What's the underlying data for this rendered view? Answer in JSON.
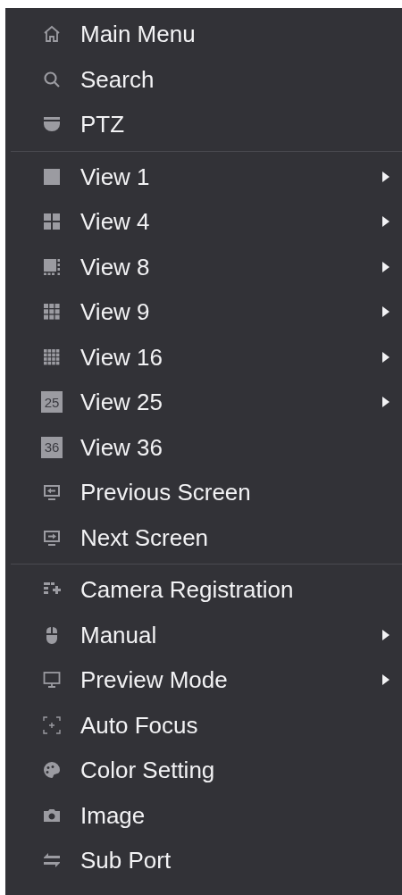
{
  "menu": {
    "sections": [
      {
        "items": [
          {
            "label": "Main Menu",
            "submenu": false
          },
          {
            "label": "Search",
            "submenu": false
          },
          {
            "label": "PTZ",
            "submenu": false
          }
        ]
      },
      {
        "items": [
          {
            "label": "View 1",
            "submenu": true
          },
          {
            "label": "View 4",
            "submenu": true
          },
          {
            "label": "View 8",
            "submenu": true
          },
          {
            "label": "View 9",
            "submenu": true
          },
          {
            "label": "View 16",
            "submenu": true
          },
          {
            "label": "View 25",
            "submenu": true,
            "icon_text": "25"
          },
          {
            "label": "View 36",
            "submenu": false,
            "icon_text": "36"
          },
          {
            "label": "Previous Screen",
            "submenu": false
          },
          {
            "label": "Next Screen",
            "submenu": false
          }
        ]
      },
      {
        "items": [
          {
            "label": "Camera Registration",
            "submenu": false
          },
          {
            "label": "Manual",
            "submenu": true
          },
          {
            "label": "Preview Mode",
            "submenu": true
          },
          {
            "label": "Auto Focus",
            "submenu": false
          },
          {
            "label": "Color Setting",
            "submenu": false
          },
          {
            "label": "Image",
            "submenu": false
          },
          {
            "label": "Sub Port",
            "submenu": false
          }
        ]
      }
    ]
  }
}
